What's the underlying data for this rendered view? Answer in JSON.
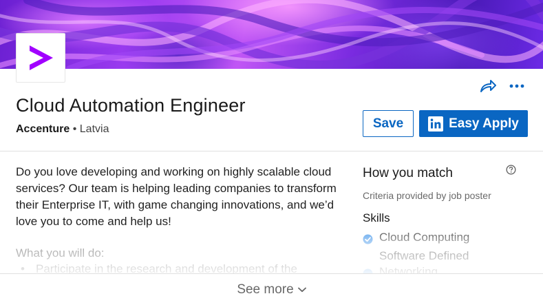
{
  "job": {
    "title": "Cloud Automation Engineer",
    "company": "Accenture",
    "separator": "•",
    "location": "Latvia"
  },
  "actions": {
    "save_label": "Save",
    "apply_label": "Easy Apply",
    "share_icon": "share-arrow-icon",
    "more_icon": "more-dots-icon"
  },
  "description": {
    "intro": "Do you love developing and working on highly scalable cloud services? Our team is helping leading companies to transform their Enterprise IT, with game changing innovations, and we’d love you to come and help us!",
    "subhead": "What you will do:",
    "bullet_1": "Participate in the research and development of the"
  },
  "match": {
    "title": "How you match",
    "criteria": "Criteria provided by job poster",
    "skills_heading": "Skills",
    "skills": [
      {
        "label": "Cloud Computing",
        "matched": true
      },
      {
        "label": "Software Defined",
        "matched": false
      },
      {
        "label": "Networking",
        "matched": false
      }
    ]
  },
  "footer": {
    "see_more": "See more"
  },
  "colors": {
    "brand_blue": "#0a66c2",
    "accenture_purple": "#a100ff",
    "check_blue": "#378fe9"
  }
}
